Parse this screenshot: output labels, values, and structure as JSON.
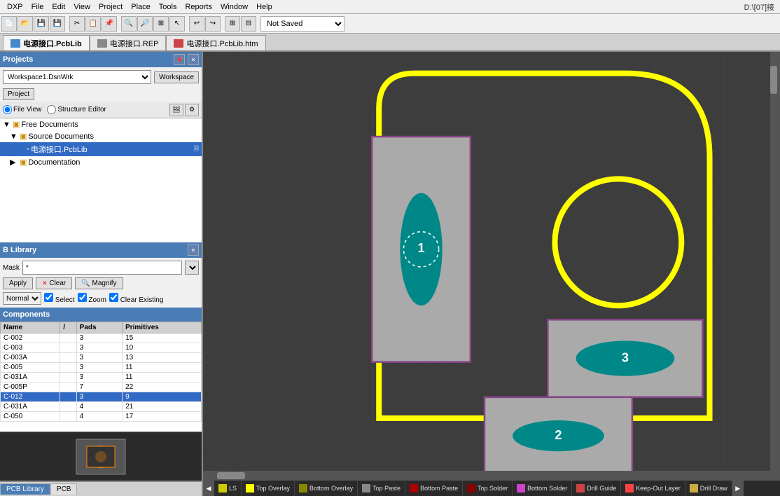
{
  "title": "DXP",
  "titlebar_right": "D:\\[07]接",
  "menubar": {
    "items": [
      "DXP",
      "File",
      "Edit",
      "View",
      "Project",
      "Place",
      "Tools",
      "Reports",
      "Window",
      "Help"
    ]
  },
  "toolbar": {
    "save_label": "Not Saved",
    "dropdown_options": [
      "Not Saved"
    ]
  },
  "tabs": {
    "items": [
      {
        "label": "电源接口.PcbLib",
        "icon": "pcb",
        "active": true
      },
      {
        "label": "电源接口.REP",
        "icon": "rep",
        "active": false
      },
      {
        "label": "电源接口.PcbLib.htm",
        "icon": "htm",
        "active": false
      }
    ]
  },
  "left": {
    "projects_header": "Projects",
    "workspace_label": "Workspace",
    "project_label": "Project",
    "workspace_dropdown": "Workspace1.DsnWrk",
    "file_view_label": "File View",
    "structure_editor_label": "Structure Editor",
    "tree": [
      {
        "label": "Free Documents",
        "level": 0,
        "type": "folder",
        "expanded": true
      },
      {
        "label": "Source Documents",
        "level": 1,
        "type": "folder",
        "expanded": true
      },
      {
        "label": "电源接口.PcbLib",
        "level": 2,
        "type": "pcb",
        "selected": true
      },
      {
        "label": "Documentation",
        "level": 1,
        "type": "folder",
        "expanded": false
      }
    ],
    "pcblib_header": "B Library",
    "mask_label": "Mask",
    "mask_value": "*",
    "apply_label": "Apply",
    "clear_label": "Clear",
    "magnify_label": "Magnify",
    "normal_label": "Normal",
    "select_label": "Select",
    "zoom_label": "Zoom",
    "clear_existing_label": "Clear Existing",
    "components_header": "Components",
    "table_headers": [
      "Name",
      "/",
      "Pads",
      "Primitives"
    ],
    "components": [
      {
        "name": "C-002",
        "sort": "",
        "pads": "3",
        "primitives": "15"
      },
      {
        "name": "C-003",
        "sort": "",
        "pads": "3",
        "primitives": "10"
      },
      {
        "name": "C-003A",
        "sort": "",
        "pads": "3",
        "primitives": "13"
      },
      {
        "name": "C-005",
        "sort": "",
        "pads": "3",
        "primitives": "11"
      },
      {
        "name": "C-031A",
        "sort": "",
        "pads": "3",
        "primitives": "11"
      },
      {
        "name": "C-005P",
        "sort": "",
        "pads": "7",
        "primitives": "22"
      },
      {
        "name": "C-012",
        "sort": "",
        "pads": "3",
        "primitives": "9",
        "selected": true
      },
      {
        "name": "C-031A",
        "sort": "",
        "pads": "4",
        "primitives": "21"
      },
      {
        "name": "C-050",
        "sort": "",
        "pads": "4",
        "primitives": "17"
      }
    ]
  },
  "bottom_tabs": [
    {
      "label": "PCB Library",
      "active": true
    },
    {
      "label": "PCB",
      "active": false
    }
  ],
  "layers": [
    {
      "label": "LS",
      "color": "#cccc00"
    },
    {
      "label": "Top Overlay",
      "color": "#ffff00"
    },
    {
      "label": "Bottom Overlay",
      "color": "#888800"
    },
    {
      "label": "Top Paste",
      "color": "#888888"
    },
    {
      "label": "Bottom Paste",
      "color": "#aa0000"
    },
    {
      "label": "Top Solder",
      "color": "#880000"
    },
    {
      "label": "Bottom Solder",
      "color": "#cc44cc"
    },
    {
      "label": "Drill Guide",
      "color": "#cc4444"
    },
    {
      "label": "Keep-Out Layer",
      "color": "#ff4444"
    },
    {
      "label": "Drill Draw",
      "color": "#ccaa44"
    }
  ]
}
